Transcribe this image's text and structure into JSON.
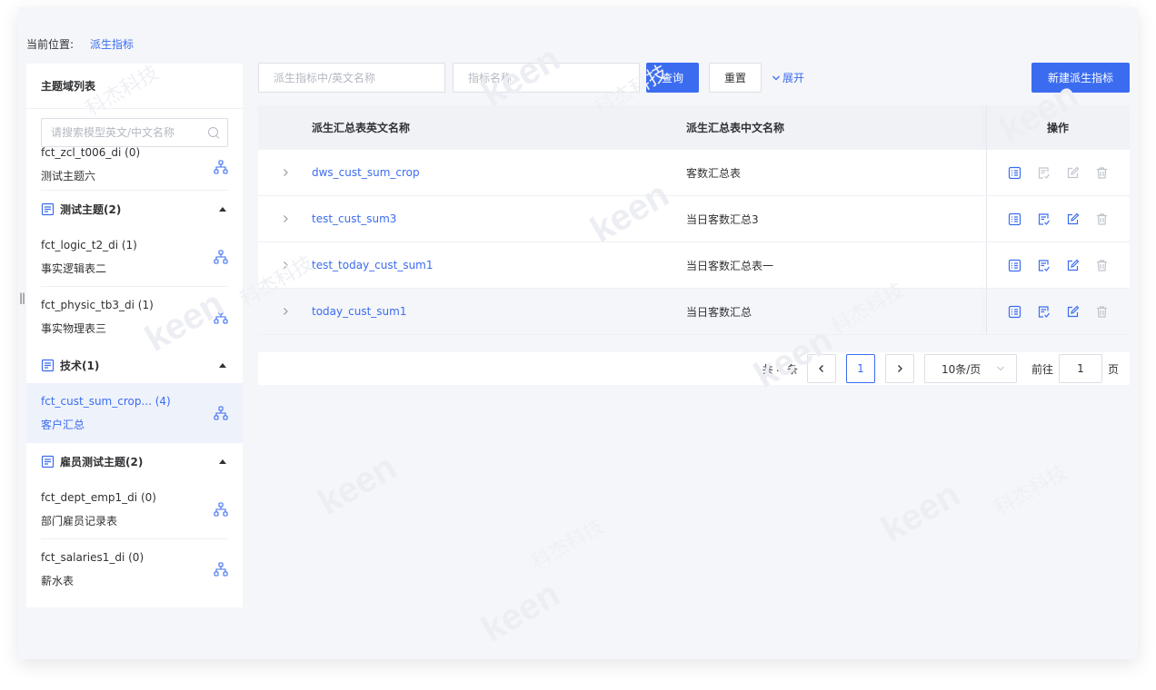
{
  "breadcrumb": {
    "label": "当前位置:",
    "current": "派生指标"
  },
  "sidebar": {
    "title": "主题域列表",
    "search_placeholder": "请搜索模型英文/中文名称",
    "top_item": {
      "en": "fct_zcl_t006_di (0)",
      "cn": "测试主题六"
    },
    "groups": [
      {
        "title": "测试主题(2)",
        "items": [
          {
            "en": "fct_logic_t2_di (1)",
            "cn": "事实逻辑表二"
          },
          {
            "en": "fct_physic_tb3_di (1)",
            "cn": "事实物理表三"
          }
        ]
      },
      {
        "title": "技术(1)",
        "items": [
          {
            "en": "fct_cust_sum_crop... (4)",
            "cn": "客户汇总",
            "selected": true
          }
        ]
      },
      {
        "title": "雇员测试主题(2)",
        "items": [
          {
            "en": "fct_dept_emp1_di (0)",
            "cn": "部门雇员记录表"
          },
          {
            "en": "fct_salaries1_di (0)",
            "cn": "薪水表"
          }
        ]
      }
    ]
  },
  "toolbar": {
    "input1_placeholder": "派生指标中/英文名称",
    "input2_placeholder": "指标名称",
    "query_label": "查询",
    "reset_label": "重置",
    "expand_label": "展开",
    "new_label": "新建派生指标"
  },
  "table": {
    "headers": {
      "en": "派生汇总表英文名称",
      "cn": "派生汇总表中文名称",
      "op": "操作"
    },
    "rows": [
      {
        "en": "dws_cust_sum_crop",
        "cn": "客数汇总表"
      },
      {
        "en": "test_cust_sum3",
        "cn": "当日客数汇总3"
      },
      {
        "en": "test_today_cust_sum1",
        "cn": "当日客数汇总表一"
      },
      {
        "en": "today_cust_sum1",
        "cn": "当日客数汇总"
      }
    ],
    "icons": [
      "detail-icon",
      "review-icon",
      "edit-icon",
      "delete-icon"
    ]
  },
  "pagination": {
    "total_label": "共 4 条",
    "current_page": "1",
    "page_size": "10条/页",
    "goto_label": "前往",
    "goto_value": "1",
    "page_suffix": "页"
  },
  "watermark": {
    "text": "keen",
    "cn": "科杰科技"
  },
  "colors": {
    "primary": "#3b6cf0",
    "text": "#303133",
    "muted": "#b4b8c2",
    "bg": "#f5f6fa"
  }
}
